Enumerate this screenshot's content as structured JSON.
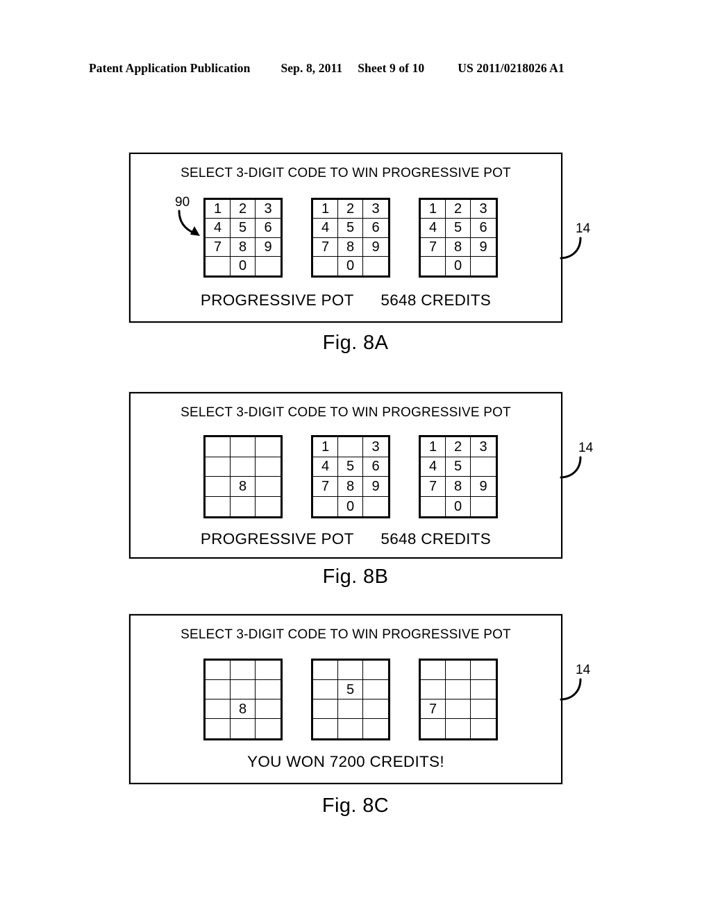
{
  "header": {
    "publication": "Patent Application Publication",
    "date": "Sep. 8, 2011",
    "sheet": "Sheet 9 of 10",
    "number": "US 2011/0218026 A1"
  },
  "figures": [
    {
      "caption": "Fig. 8A",
      "title": "SELECT 3-DIGIT CODE TO WIN PROGRESSIVE POT",
      "footer_left": "PROGRESSIVE POT",
      "footer_right": "5648 CREDITS",
      "callout_device": "14",
      "callout_keypad": "90",
      "keypads": [
        {
          "cells": [
            "1",
            "2",
            "3",
            "4",
            "5",
            "6",
            "7",
            "8",
            "9",
            "",
            "0",
            ""
          ]
        },
        {
          "cells": [
            "1",
            "2",
            "3",
            "4",
            "5",
            "6",
            "7",
            "8",
            "9",
            "",
            "0",
            ""
          ]
        },
        {
          "cells": [
            "1",
            "2",
            "3",
            "4",
            "5",
            "6",
            "7",
            "8",
            "9",
            "",
            "0",
            ""
          ]
        }
      ]
    },
    {
      "caption": "Fig. 8B",
      "title": "SELECT 3-DIGIT CODE TO WIN PROGRESSIVE POT",
      "footer_left": "PROGRESSIVE POT",
      "footer_right": "5648 CREDITS",
      "callout_device": "14",
      "callout_keypad": "",
      "keypads": [
        {
          "cells": [
            "",
            "",
            "",
            "",
            "",
            "",
            "",
            "8",
            "",
            "",
            "",
            ""
          ]
        },
        {
          "cells": [
            "1",
            "",
            "3",
            "4",
            "5",
            "6",
            "7",
            "8",
            "9",
            "",
            "0",
            ""
          ]
        },
        {
          "cells": [
            "1",
            "2",
            "3",
            "4",
            "5",
            "",
            "7",
            "8",
            "9",
            "",
            "0",
            ""
          ]
        }
      ]
    },
    {
      "caption": "Fig. 8C",
      "title": "SELECT 3-DIGIT CODE TO WIN PROGRESSIVE POT",
      "footer_left": "YOU WON 7200 CREDITS!",
      "footer_right": "",
      "callout_device": "14",
      "callout_keypad": "",
      "keypads": [
        {
          "cells": [
            "",
            "",
            "",
            "",
            "",
            "",
            "",
            "8",
            "",
            "",
            "",
            ""
          ]
        },
        {
          "cells": [
            "",
            "",
            "",
            "",
            "5",
            "",
            "",
            "",
            "",
            "",
            "",
            ""
          ]
        },
        {
          "cells": [
            "",
            "",
            "",
            "",
            "",
            "",
            "7",
            "",
            "",
            "",
            "",
            ""
          ]
        }
      ]
    }
  ]
}
